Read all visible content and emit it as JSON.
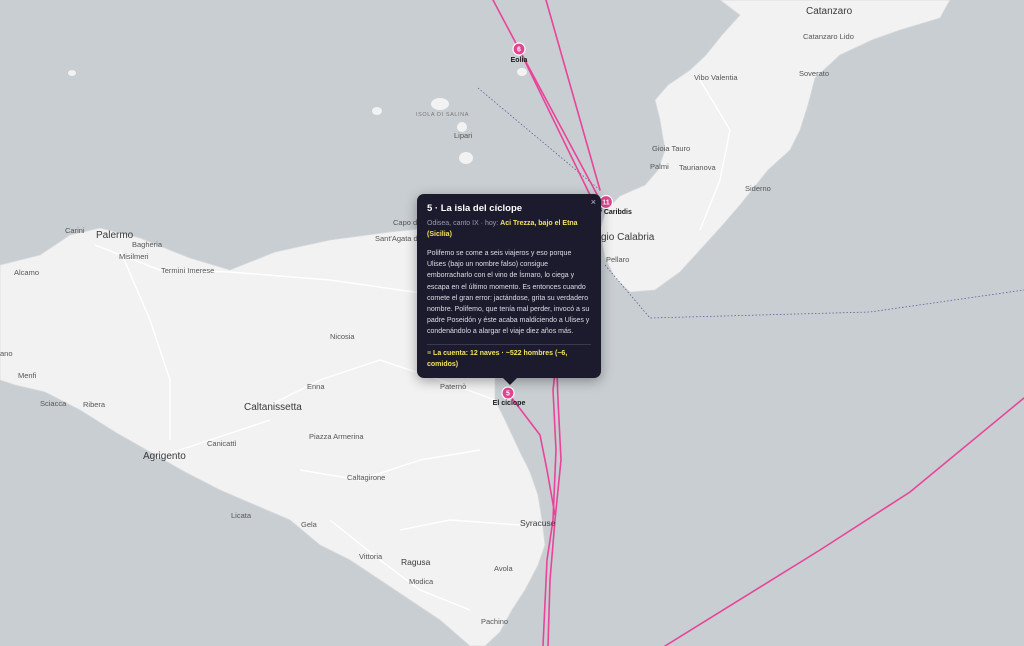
{
  "map": {
    "colors": {
      "sea": "#c9ced2",
      "land": "#f2f2f2",
      "route": "#e8449a",
      "marker": "#e0458f",
      "popup_bg": "#1c1b2e",
      "highlight": "#f2e25c"
    },
    "places": {
      "catanzaro": "Catanzaro",
      "catanzaro_lido": "Catanzaro Lido",
      "vibo_valentia": "Vibo Valentia",
      "soverato": "Soverato",
      "gioia_tauro": "Gioia Tauro",
      "palmi": "Palmi",
      "taurianova": "Taurianova",
      "siderno": "Siderno",
      "reggio": "gio Calabria",
      "pellaro": "Pellaro",
      "lipari": "Lipari",
      "isola_salina": "ISOLA DI SALINA",
      "carini": "Carini",
      "palermo": "Palermo",
      "bagheria": "Bagheria",
      "misilmeri": "Misilmeri",
      "termini": "Termini Imerese",
      "alcamo": "Alcamo",
      "capo": "Capo d",
      "santagata": "Sant'Agata di Militello",
      "nicosia": "Nicosia",
      "mazara": "ano",
      "menfi": "Menfi",
      "sciacca": "Sciacca",
      "ribera": "Ribera",
      "enna": "Enna",
      "paterno": "Paternò",
      "caltanissetta": "Caltanissetta",
      "canicatti": "Canicattì",
      "piazza": "Piazza Armerina",
      "agrigento": "Agrigento",
      "caltagirone": "Caltagirone",
      "licata": "Licata",
      "gela": "Gela",
      "syracuse": "Syracuse",
      "vittoria": "Vittoria",
      "ragusa": "Ragusa",
      "avola": "Avola",
      "modica": "Modica",
      "pachino": "Pachino"
    },
    "markers": [
      {
        "number": "6",
        "label": "Eolia"
      },
      {
        "number": "11",
        "label": "y Caribdis"
      },
      {
        "number": "5",
        "label": "El cíclope"
      }
    ]
  },
  "popup": {
    "close": "×",
    "title": "5 · La isla del cíclope",
    "source": "Odisea, canto IX · hoy:",
    "place_today": "Aci Trezza, bajo el Etna (Sicilia)",
    "body": "Polifemo se come a seis viajeros y eso porque Ulises (bajo un nombre falso) consigue emborracharlo con el vino de Ísmaro, lo ciega y escapa en el último momento. Es entonces cuando comete el gran error: jactándose, grita su verdadero nombre. Polifemo, que tenía mal perder, invocó a su padre Poseidón y éste acaba maldiciendo a Ulises y condenándolo a alargar el viaje diez años más.",
    "count_bullet": "≡",
    "count": "La cuenta: 12 naves · ~522 hombres (−6, comidos)"
  }
}
